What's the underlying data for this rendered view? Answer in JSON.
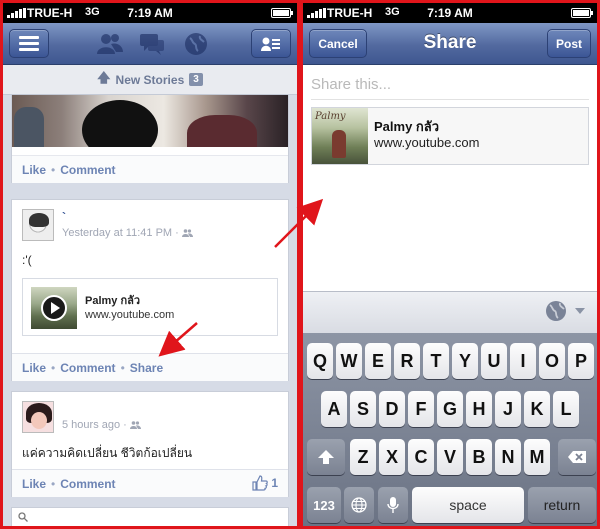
{
  "left": {
    "status_bar": {
      "carrier": "TRUE-H",
      "network": "3G",
      "time": "7:19 AM"
    },
    "nav": {
      "icons": [
        "menu-icon",
        "friend-requests-icon",
        "messages-icon",
        "notifications-globe-icon",
        "friend-list-icon"
      ]
    },
    "new_stories": {
      "label": "New Stories",
      "count": "3"
    },
    "photo_post": {
      "like": "Like",
      "comment": "Comment"
    },
    "share_post": {
      "author": "`",
      "time": "Yesterday at 11:41 PM",
      "text": ":'(",
      "link": {
        "title": "Palmy กลัว",
        "url": "www.youtube.com"
      },
      "like": "Like",
      "comment": "Comment",
      "share": "Share"
    },
    "thai_post": {
      "time": "5 hours ago",
      "text": "แค่ความคิดเปลี่ยน ชีวิตก้อเปลี่ยน",
      "like": "Like",
      "comment": "Comment",
      "like_count": "1"
    }
  },
  "right": {
    "status_bar": {
      "carrier": "TRUE-H",
      "network": "3G",
      "time": "7:19 AM"
    },
    "nav": {
      "title": "Share",
      "cancel": "Cancel",
      "post": "Post"
    },
    "share_input": {
      "placeholder": "Share this..."
    },
    "attachment": {
      "title": "Palmy กลัว",
      "url": "www.youtube.com",
      "thumb_text": "Palmy"
    },
    "keyboard": {
      "row1": [
        "Q",
        "W",
        "E",
        "R",
        "T",
        "Y",
        "U",
        "I",
        "O",
        "P"
      ],
      "row2": [
        "A",
        "S",
        "D",
        "F",
        "G",
        "H",
        "J",
        "K",
        "L"
      ],
      "row3": [
        "Z",
        "X",
        "C",
        "V",
        "B",
        "N",
        "M"
      ],
      "numbers": "123",
      "space": "space",
      "return": "return"
    }
  },
  "colors": {
    "annotation_arrow": "#e0151b",
    "nav_blue": "#3e5790",
    "link_blue": "#6d84b4"
  }
}
